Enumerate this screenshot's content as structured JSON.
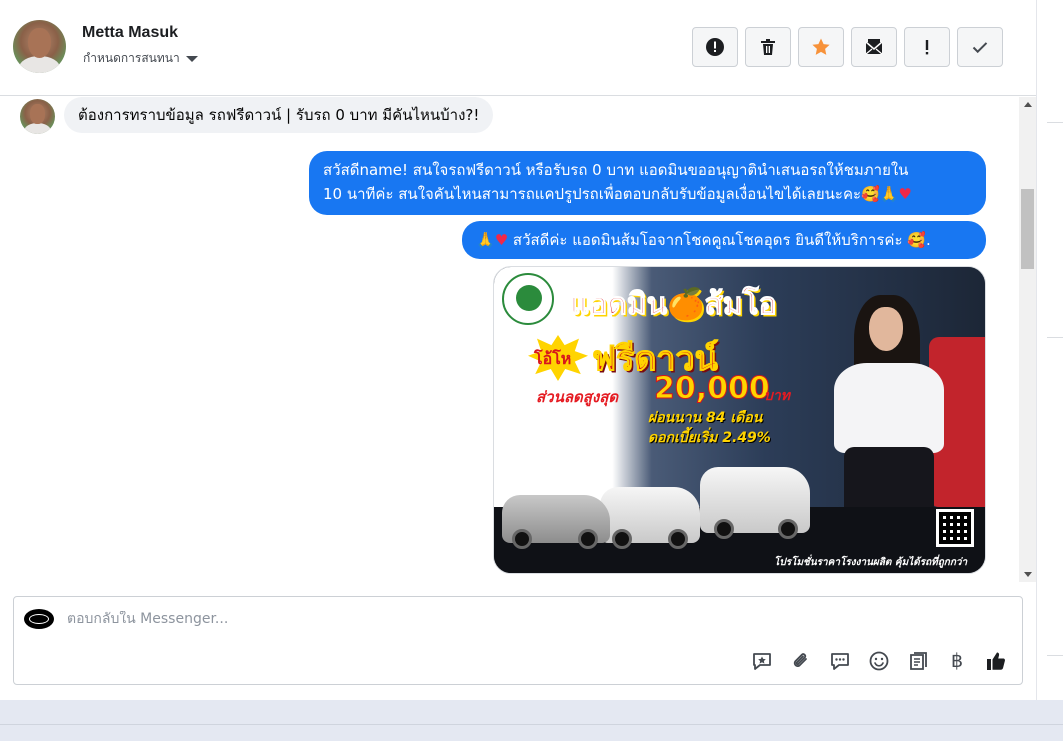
{
  "header": {
    "contact_name": "Metta Masuk",
    "assign_label": "กำหนดการสนทนา"
  },
  "toolbar": [
    {
      "name": "report-spam-button",
      "icon": "alert-circle-icon"
    },
    {
      "name": "delete-button",
      "icon": "trash-icon"
    },
    {
      "name": "star-button",
      "icon": "star-icon",
      "color": "#f7923a"
    },
    {
      "name": "mark-unread-button",
      "icon": "envelope-icon"
    },
    {
      "name": "follow-up-button",
      "icon": "exclamation-icon"
    },
    {
      "name": "done-button",
      "icon": "check-icon"
    }
  ],
  "messages": {
    "incoming_1": "ต้องการทราบข้อมูล รถฟรีดาวน์ | รับรถ 0 บาท มีคันไหนบ้าง?!",
    "outgoing_1_line1": "สวัสดีname! สนใจรถฟรีดาวน์ หรือรับรถ 0 บาท แอดมินขออนุญาตินำเสนอรถให้ชมภายใน",
    "outgoing_1_line2": "10 นาทีค่ะ สนใจคันไหนสามารถแคปรูปรถเพื่อตอบกลับรับข้อมูลเงื่อนไขได้เลยนะคะ🥰🙏",
    "outgoing_2_prefix": "🙏",
    "outgoing_2_text": " สวัสดีค่ะ แอดมินส้มโอจากโชคคูณโชคอุดร ยินดีให้บริการค่ะ 🥰.",
    "heart": "♥",
    "accent_color": "#1877f2"
  },
  "promo": {
    "title": "แอดมิน🍊ส้มโอ",
    "badge": "โอ้โห",
    "headline": "ฟรีดาวน์",
    "discount_label": "ส่วนลดสูงสุด",
    "discount_amount": "20,000",
    "currency": "บาท",
    "installment": "ผ่อนนาน 84 เดือน",
    "interest": "ดอกเบี้ยเริ่ม 2.49%",
    "footer": "โปรโมชั่นราคาโรงงานผลิต คุ้มได้รถที่ถูกกว่า"
  },
  "composer": {
    "placeholder": "ตอบกลับใน Messenger...",
    "icons": [
      "saved-reply-icon",
      "attachment-icon",
      "chat-bubble-icon",
      "emoji-icon",
      "notes-icon",
      "baht-icon",
      "like-icon"
    ],
    "baht_symbol": "฿"
  }
}
